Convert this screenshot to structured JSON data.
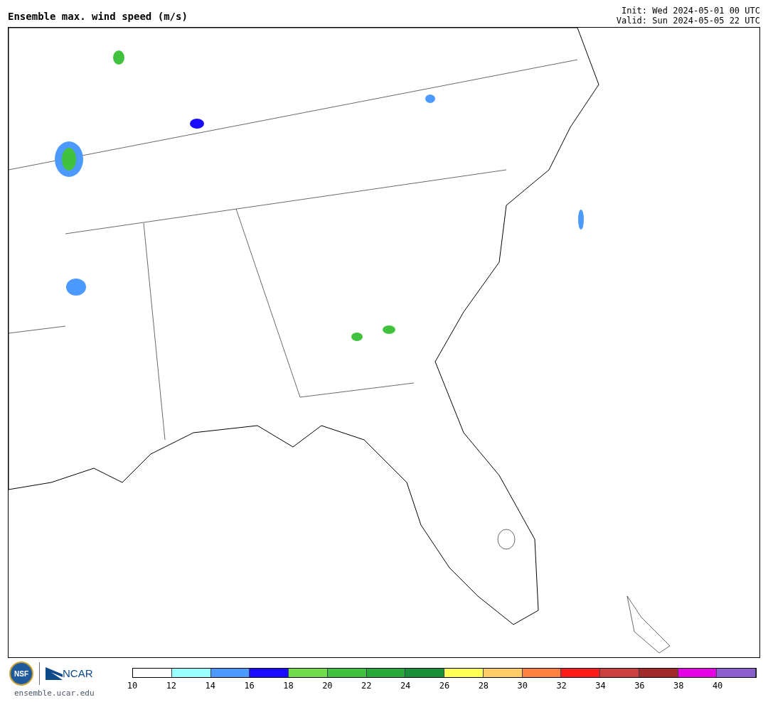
{
  "title": "Ensemble max. wind speed (m/s)",
  "init": "Init: Wed 2024-05-01 00 UTC",
  "valid": "Valid: Sun 2024-05-05 22 UTC",
  "logos": {
    "nsf": "NSF",
    "ncar": "NCAR",
    "url": "ensemble.ucar.edu"
  },
  "legend": {
    "swatches": [
      {
        "color": "#ffffff"
      },
      {
        "color": "#99ffff"
      },
      {
        "color": "#4d9aff"
      },
      {
        "color": "#1a0aff"
      },
      {
        "color": "#73dc4c"
      },
      {
        "color": "#41c23e"
      },
      {
        "color": "#29a83a"
      },
      {
        "color": "#1a8f3a"
      },
      {
        "color": "#ffff55"
      },
      {
        "color": "#ffcc66"
      },
      {
        "color": "#ff8040"
      },
      {
        "color": "#ff1a1a"
      },
      {
        "color": "#cc3f3f"
      },
      {
        "color": "#a02a2a"
      },
      {
        "color": "#e600e6"
      },
      {
        "color": "#8c60cc"
      }
    ],
    "ticks": [
      "10",
      "12",
      "14",
      "16",
      "18",
      "20",
      "22",
      "24",
      "26",
      "28",
      "30",
      "32",
      "34",
      "36",
      "38",
      "40"
    ]
  }
}
